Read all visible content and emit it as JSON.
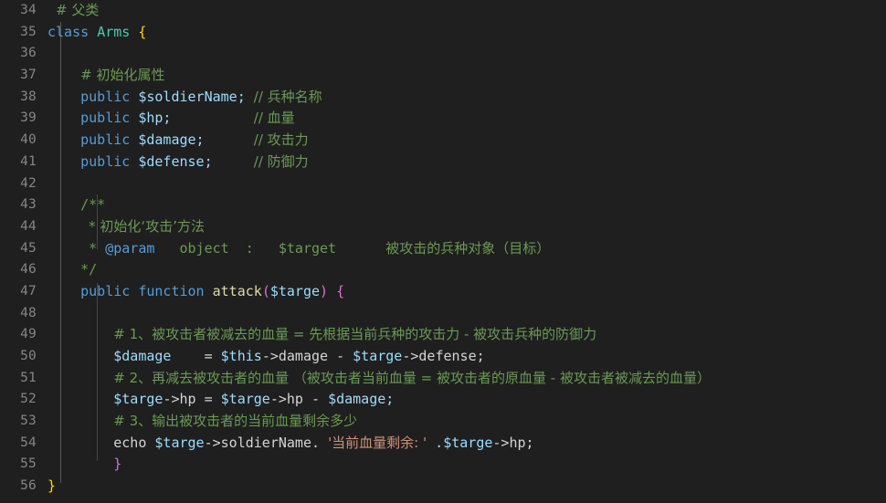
{
  "editor": {
    "background_color": "#1f1f1f",
    "gutter_color": "#858585",
    "language": "PHP",
    "first_line_number": 34,
    "last_line_number": 56
  },
  "colors": {
    "keyword": "#569cd6",
    "class_name": "#4ec9b0",
    "function_name": "#dcdcaa",
    "variable": "#9cdcfe",
    "string": "#ce9178",
    "comment": "#6a9955",
    "bracket_level_1": "#ffd700",
    "bracket_level_2": "#da70d6",
    "plain_text": "#d4d4d4"
  },
  "line_numbers": [
    "34",
    "35",
    "36",
    "37",
    "38",
    "39",
    "40",
    "41",
    "42",
    "43",
    "44",
    "45",
    "46",
    "47",
    "48",
    "49",
    "50",
    "51",
    "52",
    "53",
    "54",
    "55",
    "56"
  ],
  "lines": [
    {
      "n": "34",
      "text": "    # 父类"
    },
    {
      "n": "35",
      "text": "class Arms {"
    },
    {
      "n": "36",
      "text": ""
    },
    {
      "n": "37",
      "text": "    # 初始化属性"
    },
    {
      "n": "38",
      "text": "    public $soldierName; // 兵种名称"
    },
    {
      "n": "39",
      "text": "    public $hp;          // 血量"
    },
    {
      "n": "40",
      "text": "    public $damage;      // 攻击力"
    },
    {
      "n": "41",
      "text": "    public $defense;     // 防御力"
    },
    {
      "n": "42",
      "text": ""
    },
    {
      "n": "43",
      "text": "    /**"
    },
    {
      "n": "44",
      "text": "     * 初始化‘攻击’方法"
    },
    {
      "n": "45",
      "text": "     * @param   object  :   $target      被攻击的兵种对象（目标）"
    },
    {
      "n": "46",
      "text": "    */"
    },
    {
      "n": "47",
      "text": "    public function attack($targe) {"
    },
    {
      "n": "48",
      "text": ""
    },
    {
      "n": "49",
      "text": "        # 1、被攻击者被减去的血量 = 先根据当前兵种的攻击力 - 被攻击兵种的防御力"
    },
    {
      "n": "50",
      "text": "        $damage    = $this->damage - $targe->defense;"
    },
    {
      "n": "51",
      "text": "        # 2、再减去被攻击者的血量 （被攻击者当前血量 = 被攻击者的原血量 - 被攻击者被减去的血量）"
    },
    {
      "n": "52",
      "text": "        $targe->hp = $targe->hp - $damage;"
    },
    {
      "n": "53",
      "text": "        # 3、输出被攻击者的当前血量剩余多少"
    },
    {
      "n": "54",
      "text": "        echo $targe->soldierName. '当前血量剩余: ' .$targe->hp;"
    },
    {
      "n": "55",
      "text": "        }"
    },
    {
      "n": "56",
      "text": "}"
    }
  ],
  "tokens": {
    "l34_comment": "# 父类",
    "l35_kw_class": "class",
    "l35_name": "Arms",
    "l35_brace": "{",
    "l37_comment": "# 初始化属性",
    "l38_kw": "public",
    "l38_var": "$soldierName;",
    "l38_comment": "// 兵种名称",
    "l39_kw": "public",
    "l39_var": "$hp;",
    "l39_comment": "// 血量",
    "l40_kw": "public",
    "l40_var": "$damage;",
    "l40_comment": "// 攻击力",
    "l41_kw": "public",
    "l41_var": "$defense;",
    "l41_comment": "// 防御力",
    "l43_doc": "/**",
    "l44_doc": "* 初始化‘攻击’方法",
    "l45_doc_star": "*",
    "l45_tag": "@param",
    "l45_type": "object",
    "l45_colon": ":",
    "l45_param": "$target",
    "l45_desc": "被攻击的兵种对象（目标）",
    "l46_doc": "*/",
    "l47_kw1": "public",
    "l47_kw2": "function",
    "l47_fn": "attack",
    "l47_paren_open": "(",
    "l47_arg": "$targe",
    "l47_paren_close": ")",
    "l47_brace": "{",
    "l49_comment": "# 1、被攻击者被减去的血量 = 先根据当前兵种的攻击力 - 被攻击兵种的防御力",
    "l50_var1": "$damage",
    "l50_eq": "=",
    "l50_var2": "$this",
    "l50_prop2": "->damage",
    "l50_minus": "-",
    "l50_var3": "$targe",
    "l50_prop3": "->defense;",
    "l51_comment": "# 2、再减去被攻击者的血量 （被攻击者当前血量 = 被攻击者的原血量 - 被攻击者被减去的血量）",
    "l52_var1": "$targe",
    "l52_prop1": "->hp",
    "l52_eq": "=",
    "l52_var2": "$targe",
    "l52_prop2": "->hp",
    "l52_minus": "-",
    "l52_var3": "$damage;",
    "l53_comment": "# 3、输出被攻击者的当前血量剩余多少",
    "l54_echo": "echo",
    "l54_var1": "$targe",
    "l54_prop1": "->soldierName.",
    "l54_string": "'当前血量剩余: '",
    "l54_dot_var": ".$targe",
    "l54_prop2": "->hp;",
    "l55_brace": "}",
    "l56_brace": "}"
  }
}
